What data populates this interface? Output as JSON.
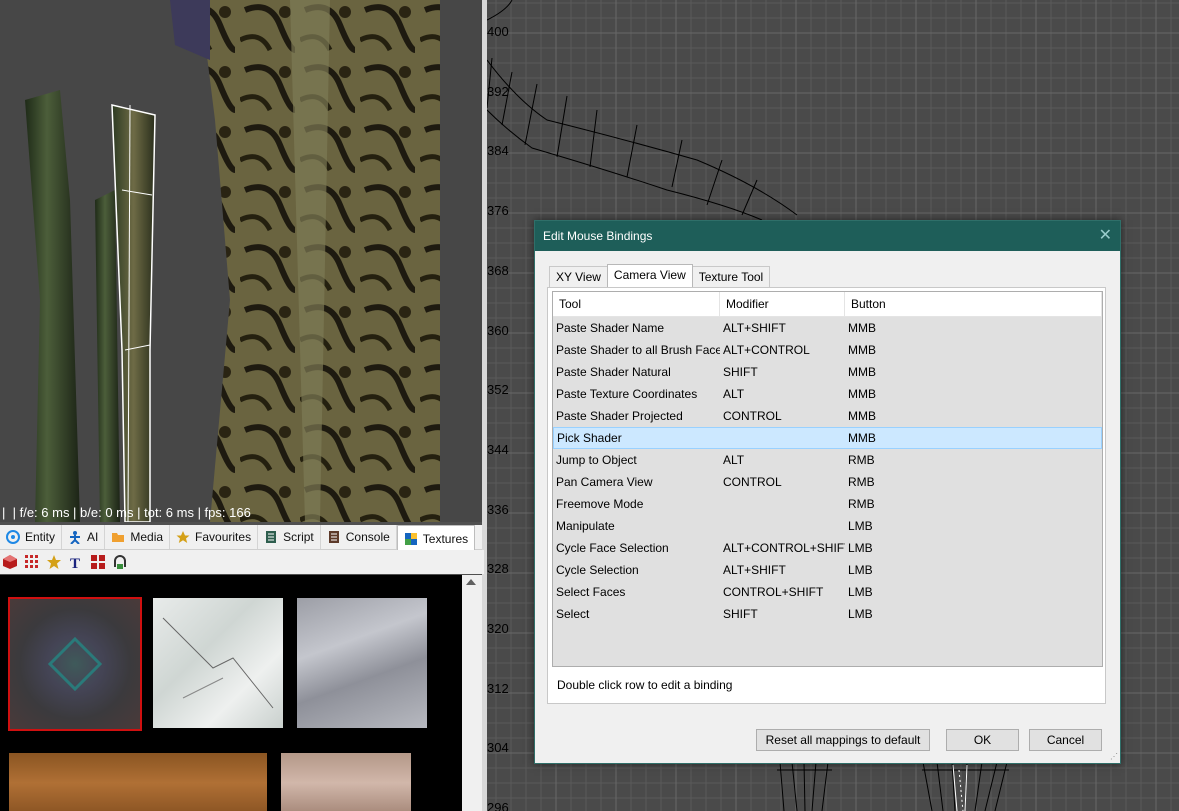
{
  "camera_view": {
    "stats": "|  | f/e: 6 ms | b/e: 0 ms | tot: 6 ms | fps: 166"
  },
  "inspector_tabs": [
    {
      "label": "Entity",
      "icon": "entity-icon",
      "color": "#1e88e5"
    },
    {
      "label": "AI",
      "icon": "ai-icon",
      "color": "#1565c0"
    },
    {
      "label": "Media",
      "icon": "folder-icon",
      "color": "#f0a030"
    },
    {
      "label": "Favourites",
      "icon": "star-icon",
      "color": "#d4a017"
    },
    {
      "label": "Script",
      "icon": "script-icon",
      "color": "#2e5e4e"
    },
    {
      "label": "Console",
      "icon": "console-icon",
      "color": "#5d3a2a"
    },
    {
      "label": "Textures",
      "icon": "textures-icon",
      "color": "#1565c0"
    }
  ],
  "grid_view": {
    "labels": [
      "400",
      "392",
      "384",
      "376",
      "368",
      "360",
      "352",
      "344",
      "336",
      "328",
      "320",
      "312",
      "304",
      "296"
    ]
  },
  "dialog": {
    "title": "Edit Mouse Bindings",
    "tabs": [
      "XY View",
      "Camera View",
      "Texture Tool"
    ],
    "active_tab": "Camera View",
    "columns": [
      "Tool",
      "Modifier",
      "Button"
    ],
    "rows": [
      {
        "tool": "Paste Shader Name",
        "modifier": "ALT+SHIFT",
        "button": "MMB"
      },
      {
        "tool": "Paste Shader to all Brush Faces",
        "modifier": "ALT+CONTROL",
        "button": "MMB"
      },
      {
        "tool": "Paste Shader Natural",
        "modifier": "SHIFT",
        "button": "MMB"
      },
      {
        "tool": "Paste Texture Coordinates",
        "modifier": "ALT",
        "button": "MMB"
      },
      {
        "tool": "Paste Shader Projected",
        "modifier": "CONTROL",
        "button": "MMB"
      },
      {
        "tool": "Pick Shader",
        "modifier": "",
        "button": "MMB"
      },
      {
        "tool": "Jump to Object",
        "modifier": "ALT",
        "button": "RMB"
      },
      {
        "tool": "Pan Camera View",
        "modifier": "CONTROL",
        "button": "RMB"
      },
      {
        "tool": "Freemove Mode",
        "modifier": "",
        "button": "RMB"
      },
      {
        "tool": "Manipulate",
        "modifier": "",
        "button": "LMB"
      },
      {
        "tool": "Cycle Face Selection",
        "modifier": "ALT+CONTROL+SHIFT",
        "button": "LMB"
      },
      {
        "tool": "Cycle Selection",
        "modifier": "ALT+SHIFT",
        "button": "LMB"
      },
      {
        "tool": "Select Faces",
        "modifier": "CONTROL+SHIFT",
        "button": "LMB"
      },
      {
        "tool": "Select",
        "modifier": "SHIFT",
        "button": "LMB"
      }
    ],
    "selected_row": "Pick Shader",
    "hint": "Double click row to edit a binding",
    "buttons": {
      "reset": "Reset all mappings to default",
      "ok": "OK",
      "cancel": "Cancel"
    }
  },
  "colors": {
    "dialog_title_bg": "#1e5e59",
    "selection_bg": "#cce8ff",
    "texture_selected_border": "#d01010"
  }
}
